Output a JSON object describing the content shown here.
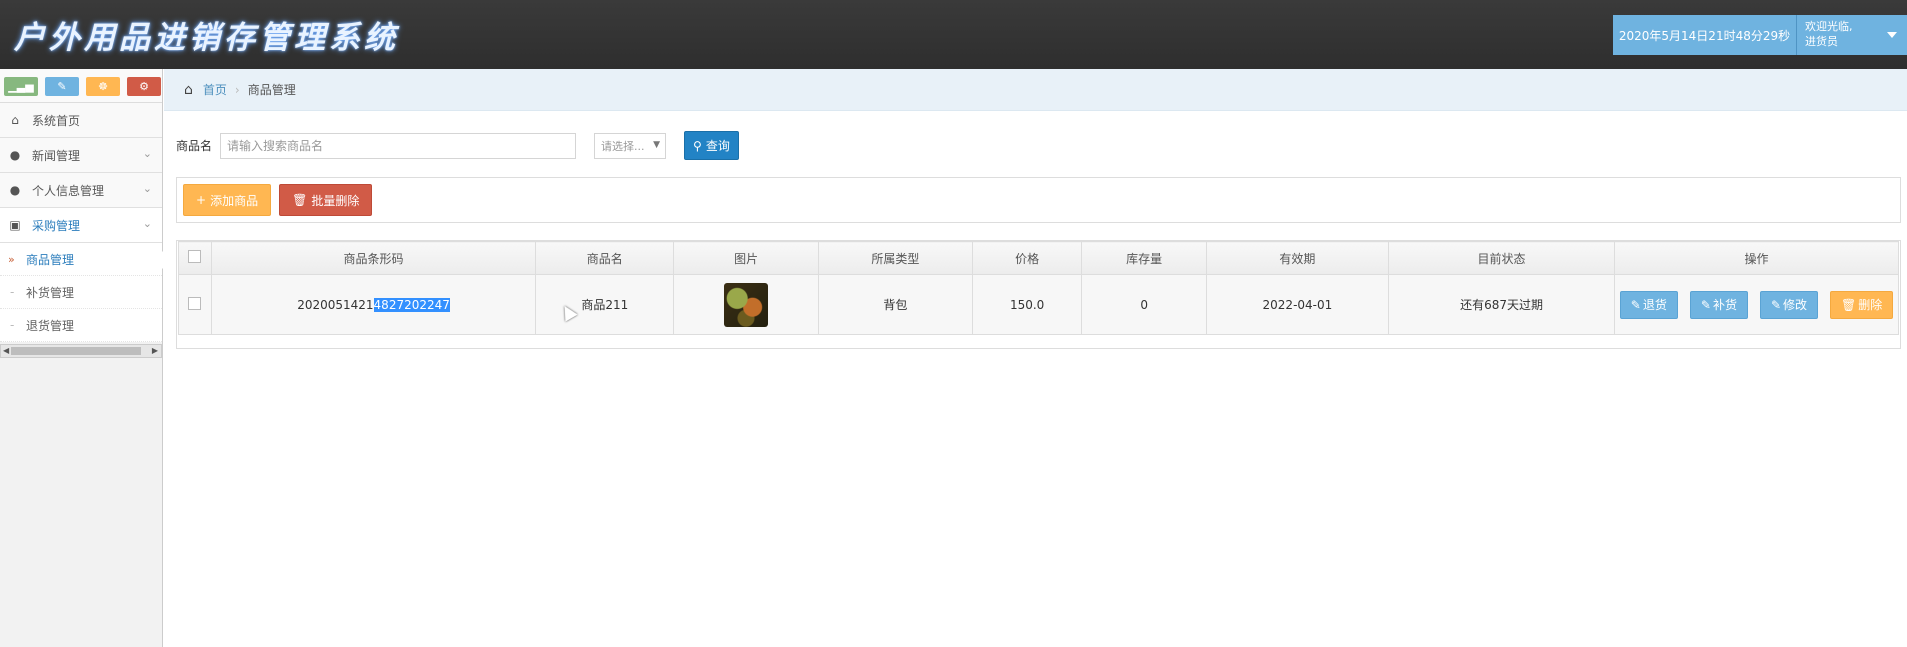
{
  "header": {
    "app_title": "户外用品进销存管理系统",
    "datetime": "2020年5月14日21时48分29秒",
    "welcome_line1": "欢迎光临,",
    "welcome_line2": "进货员"
  },
  "sidebar": {
    "shortcuts": [
      {
        "icon": "signal-icon",
        "glyph": "▁▃▅"
      },
      {
        "icon": "pencil-icon",
        "glyph": "✎"
      },
      {
        "icon": "users-icon",
        "glyph": "☸"
      },
      {
        "icon": "cogs-icon",
        "glyph": "⚙"
      }
    ],
    "items": [
      {
        "label": "系统首页"
      },
      {
        "label": "新闻管理"
      },
      {
        "label": "个人信息管理"
      },
      {
        "label": "采购管理"
      }
    ],
    "sub_items": [
      {
        "label": "商品管理"
      },
      {
        "label": "补货管理"
      },
      {
        "label": "退货管理"
      }
    ]
  },
  "breadcrumb": {
    "home": "首页",
    "current": "商品管理"
  },
  "search": {
    "label": "商品名",
    "placeholder": "请输入搜索商品名",
    "select_value": "请选择...",
    "query_label": "查询"
  },
  "toolbar": {
    "add_label": "添加商品",
    "batch_delete_label": "批量删除"
  },
  "table": {
    "headers": [
      "商品条形码",
      "商品名",
      "图片",
      "所属类型",
      "价格",
      "库存量",
      "有效期",
      "目前状态",
      "操作"
    ],
    "rows": [
      {
        "barcode_prefix": "2020051421",
        "barcode_selected": "4827202247",
        "name": "商品211",
        "type": "背包",
        "price": "150.0",
        "stock": "0",
        "expiry": "2022-04-01",
        "status": "还有687天过期",
        "actions": {
          "return": "退货",
          "restock": "补货",
          "edit": "修改",
          "delete": "删除"
        }
      }
    ]
  },
  "colors": {
    "header_bg": "#2e2e2e",
    "accent_blue": "#6fb3e0",
    "query_blue": "#2283c5",
    "add_yellow": "#ffb752",
    "delete_red": "#d15b47",
    "breadcrumb_bg": "#e8f1f8"
  }
}
